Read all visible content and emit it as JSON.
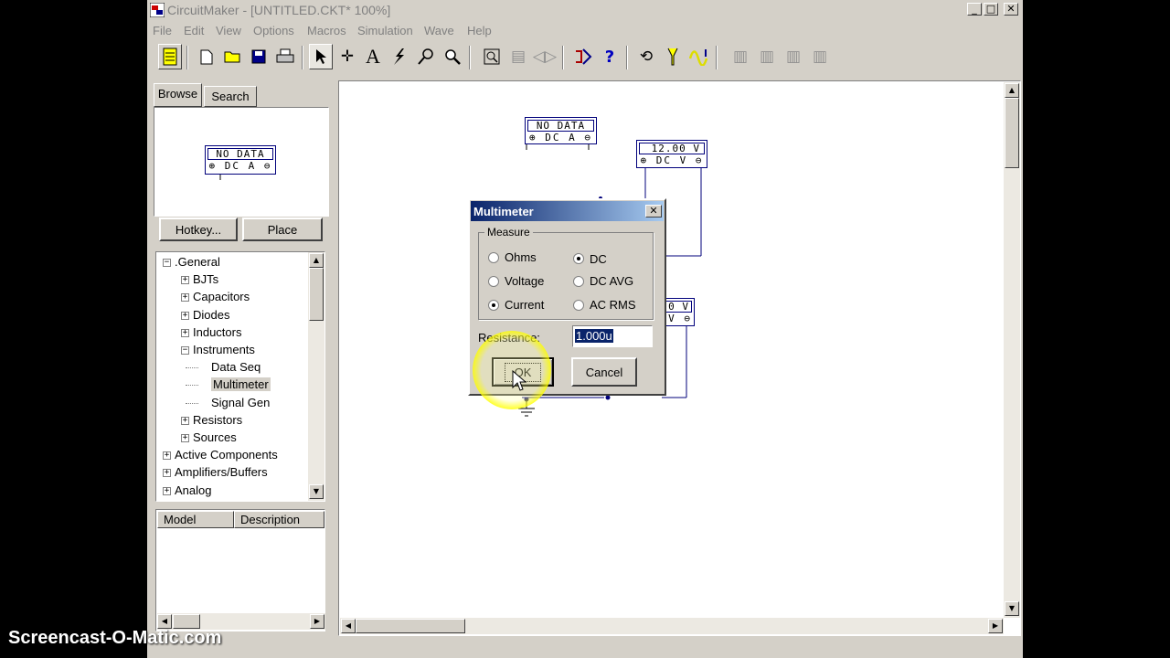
{
  "window": {
    "title": "CircuitMaker - [UNTITLED.CKT* 100%]",
    "minimize_glyph": "_",
    "maximize_glyph": "□",
    "close_glyph": "✕"
  },
  "menu": [
    "File",
    "Edit",
    "View",
    "Options",
    "Macros",
    "Simulation",
    "Wave",
    "Help"
  ],
  "toolbar_icons": [
    "db-icon",
    "new-icon",
    "open-icon",
    "save-icon",
    "print-icon",
    "arrow-icon",
    "wire-icon",
    "text-icon",
    "probe-icon",
    "zoom-tool-icon",
    "magnify-icon",
    "fit-icon",
    "step-icon",
    "reset-icon",
    "digital-sim-icon",
    "help-icon",
    "rotate-icon",
    "run-icon",
    "wave-icon",
    "b1-icon",
    "b2-icon",
    "b3-icon",
    "b4-icon"
  ],
  "browser": {
    "tabs": [
      "Browse",
      "Search"
    ],
    "preview": {
      "top": "NO DATA",
      "bottom": "⊕ DC A ⊖"
    },
    "hotkey_label": "Hotkey...",
    "place_label": "Place",
    "tree": [
      {
        "label": ".General",
        "expander": "−",
        "level": 0
      },
      {
        "label": "BJTs",
        "expander": "+",
        "level": 1
      },
      {
        "label": "Capacitors",
        "expander": "+",
        "level": 1
      },
      {
        "label": "Diodes",
        "expander": "+",
        "level": 1
      },
      {
        "label": "Inductors",
        "expander": "+",
        "level": 1
      },
      {
        "label": "Instruments",
        "expander": "−",
        "level": 1
      },
      {
        "label": "Data Seq",
        "expander": "",
        "level": 2
      },
      {
        "label": "Multimeter",
        "expander": "",
        "level": 2,
        "selected": true
      },
      {
        "label": "Signal Gen",
        "expander": "",
        "level": 2
      },
      {
        "label": "Resistors",
        "expander": "+",
        "level": 1
      },
      {
        "label": "Sources",
        "expander": "+",
        "level": 1
      },
      {
        "label": "Active Components",
        "expander": "+",
        "level": 0
      },
      {
        "label": "Amplifiers/Buffers",
        "expander": "+",
        "level": 0
      },
      {
        "label": "Analog",
        "expander": "+",
        "level": 0
      }
    ],
    "columns": [
      "Model",
      "Description"
    ]
  },
  "canvas": {
    "meter1": {
      "top": "NO DATA",
      "bottom": "⊕ DC A ⊖"
    },
    "meter2": {
      "top": "12.00 V",
      "bottom": "⊕ DC V ⊖"
    },
    "meter3": {
      "top": "0 V",
      "bottom": "V ⊖"
    }
  },
  "dialog": {
    "title": "Multimeter",
    "close_glyph": "✕",
    "group_label": "Measure",
    "mode_options": [
      {
        "label": "Ohms",
        "checked": false
      },
      {
        "label": "Voltage",
        "checked": false
      },
      {
        "label": "Current",
        "checked": true
      }
    ],
    "type_options": [
      {
        "label": "DC",
        "checked": true
      },
      {
        "label": "DC AVG",
        "checked": false
      },
      {
        "label": "AC RMS",
        "checked": false
      }
    ],
    "resistance_label": "Resistance:",
    "resistance_value": "1.000u",
    "ok_label": "OK",
    "cancel_label": "Cancel"
  },
  "watermark": "Screencast-O-Matic.com",
  "colors": {
    "title_active": "#0a246a",
    "face": "#d4d0c8",
    "canvas": "#ffffff",
    "wire": "#00007b",
    "highlight": "#fff600"
  }
}
